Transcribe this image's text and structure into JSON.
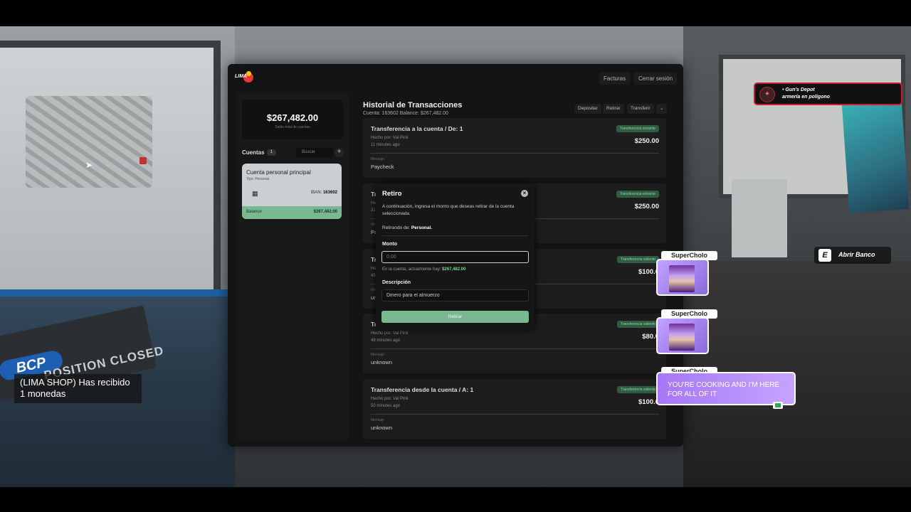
{
  "minimap": {
    "markers": [
      "map-cursor-icon",
      "waypoint-icon"
    ]
  },
  "notification": {
    "text": "(LIMA SHOP) Has recibido 1 monedas"
  },
  "scene": {
    "sign_logo": "BCP",
    "sign_text": "POSITION CLOSED"
  },
  "location": {
    "title": "• Gun's Depot",
    "subtitle": "armería en polígono"
  },
  "prompt": {
    "key": "E",
    "label": "Abrir Banco"
  },
  "app": {
    "logo_text": "LIMA",
    "top_buttons": {
      "facturas": "Facturas",
      "logout": "Cerrar sesión"
    },
    "balance": {
      "amount": "$267,482.00",
      "subtitle": "Saldo total de cuentas"
    },
    "accounts": {
      "label": "Cuentas",
      "count": "1",
      "search_placeholder": "Buscar",
      "add": "+",
      "card": {
        "name": "Cuenta personal principal",
        "type": "Tipo: Personal",
        "iban_label": "IBAN:",
        "iban": "163602",
        "footer_label": "Balance",
        "footer_value": "$267,482.00"
      }
    },
    "history": {
      "title": "Historial de Transacciones",
      "subtitle": "Cuenta: 163602  Balance: $267,482.00",
      "actions": {
        "deposit": "Depositar",
        "withdraw": "Retirar",
        "transfer": "Transferir",
        "more": "⌄"
      },
      "transactions": [
        {
          "title": "Transferencia a la cuenta / De: 1",
          "badge": "Transferencia entrante",
          "amount": "$250.00",
          "by": "Hecho por: Val Pink",
          "time": "11 minutes ago",
          "msg_label": "Mensaje",
          "msg": "Paycheck"
        },
        {
          "title": "Tr",
          "badge": "Transferencia entrante",
          "amount": "$250.00",
          "by": "He",
          "time": "31",
          "msg_label": "Me",
          "msg": "Pa"
        },
        {
          "title": "Tr",
          "badge": "Transferencia saliente",
          "amount": "$100.0",
          "by": "He",
          "time": "45",
          "msg_label": "Me",
          "msg": "un"
        },
        {
          "title": "Tra",
          "badge": "Transferencia saliente",
          "amount": "$80.0",
          "by": "Hecho por: Val Pink",
          "time": "48 minutes ago",
          "msg_label": "Mensaje",
          "msg": "unknown"
        },
        {
          "title": "Transferencia desde la cuenta / A: 1",
          "badge": "Transferencia saliente",
          "amount": "$100.0",
          "by": "Hecho por: Val Pink",
          "time": "50 minutes ago",
          "msg_label": "Mensaje",
          "msg": "unknown"
        }
      ]
    }
  },
  "modal": {
    "title": "Retiro",
    "close": "×",
    "description": "A continuación, ingresa el monto que deseas retirar de la cuenta seleccionada.",
    "from_label": "Retirando de:",
    "from_value": "Personal.",
    "amount_label": "Monto",
    "amount_placeholder": "0.00",
    "hint_label": "En la cuenta, actualmente hay:",
    "hint_value": "$267,482.00",
    "desc_label": "Descripción",
    "desc_value": "Dinero para el almuerzo",
    "submit": "Retirar"
  },
  "chat": {
    "messages": [
      {
        "name": "SuperCholo",
        "kind": "image"
      },
      {
        "name": "SuperCholo",
        "kind": "image"
      },
      {
        "name": "SuperCholo",
        "kind": "text",
        "text": "YOU'RE COOKING AND I'M HERE FOR ALL OF IT"
      }
    ]
  }
}
